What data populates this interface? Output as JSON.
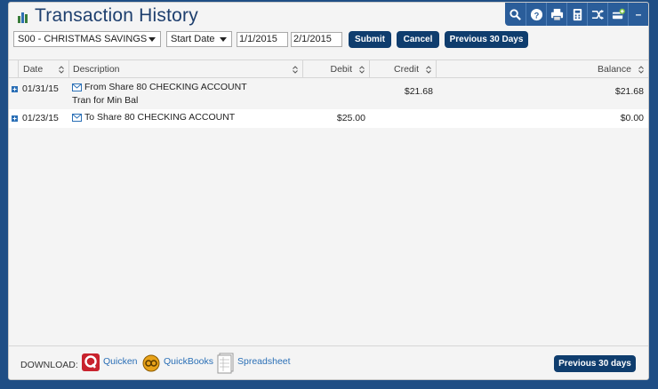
{
  "header": {
    "title": "Transaction History"
  },
  "toolbar": {
    "icons": [
      "search-icon",
      "help-icon",
      "print-icon",
      "calculator-icon",
      "transfer-icon",
      "add-card-icon",
      "minimize-icon"
    ],
    "help_glyph": "?",
    "minimize_glyph": "–"
  },
  "filters": {
    "account": "S00 - CHRISTMAS SAVINGS",
    "date_type": "Start Date",
    "start_date": "1/1/2015",
    "end_date": "2/1/2015",
    "submit_label": "Submit",
    "cancel_label": "Cancel",
    "previous_label": "Previous 30 Days"
  },
  "table": {
    "columns": {
      "date": "Date",
      "description": "Description",
      "debit": "Debit",
      "credit": "Credit",
      "balance": "Balance"
    },
    "rows": [
      {
        "date": "01/31/15",
        "description": "From Share 80 CHECKING ACCOUNT",
        "memo": "Tran for Min Bal",
        "debit": "",
        "credit": "$21.68",
        "balance": "$21.68"
      },
      {
        "date": "01/23/15",
        "description": "To Share 80 CHECKING ACCOUNT",
        "memo": "",
        "debit": "$25.00",
        "credit": "",
        "balance": "$0.00"
      }
    ]
  },
  "footer": {
    "download_label": "DOWNLOAD:",
    "quicken_label": "Quicken",
    "quickbooks_label": "QuickBooks",
    "spreadsheet_label": "Spreadsheet",
    "previous_label": "Previous 30 days"
  },
  "colors": {
    "background": "#1f4e85",
    "button": "#0f3d6e",
    "link": "#2a6fb6",
    "title": "#1e3f6e"
  }
}
